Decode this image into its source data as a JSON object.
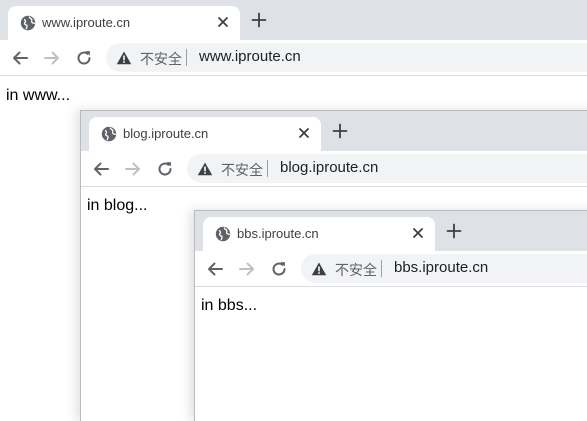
{
  "windows": [
    {
      "id": "www",
      "tab_title": "www.iproute.cn",
      "security_label": "不安全",
      "url": "www.iproute.cn",
      "content_text": "in www..."
    },
    {
      "id": "blog",
      "tab_title": "blog.iproute.cn",
      "security_label": "不安全",
      "url": "blog.iproute.cn",
      "content_text": "in blog..."
    },
    {
      "id": "bbs",
      "tab_title": "bbs.iproute.cn",
      "security_label": "不安全",
      "url": "bbs.iproute.cn",
      "content_text": "in bbs..."
    }
  ],
  "icons": {
    "tab_favicon": "globe-icon",
    "tab_close": "close-icon",
    "new_tab": "plus-icon",
    "back": "arrow-left-icon",
    "forward": "arrow-right-icon",
    "reload": "reload-icon",
    "security": "warning-triangle-icon"
  },
  "colors": {
    "tabstrip": "#dee1e6",
    "omnibox": "#f1f3f4",
    "icon": "#5f6368",
    "icon_disabled": "#bdc1c6"
  }
}
